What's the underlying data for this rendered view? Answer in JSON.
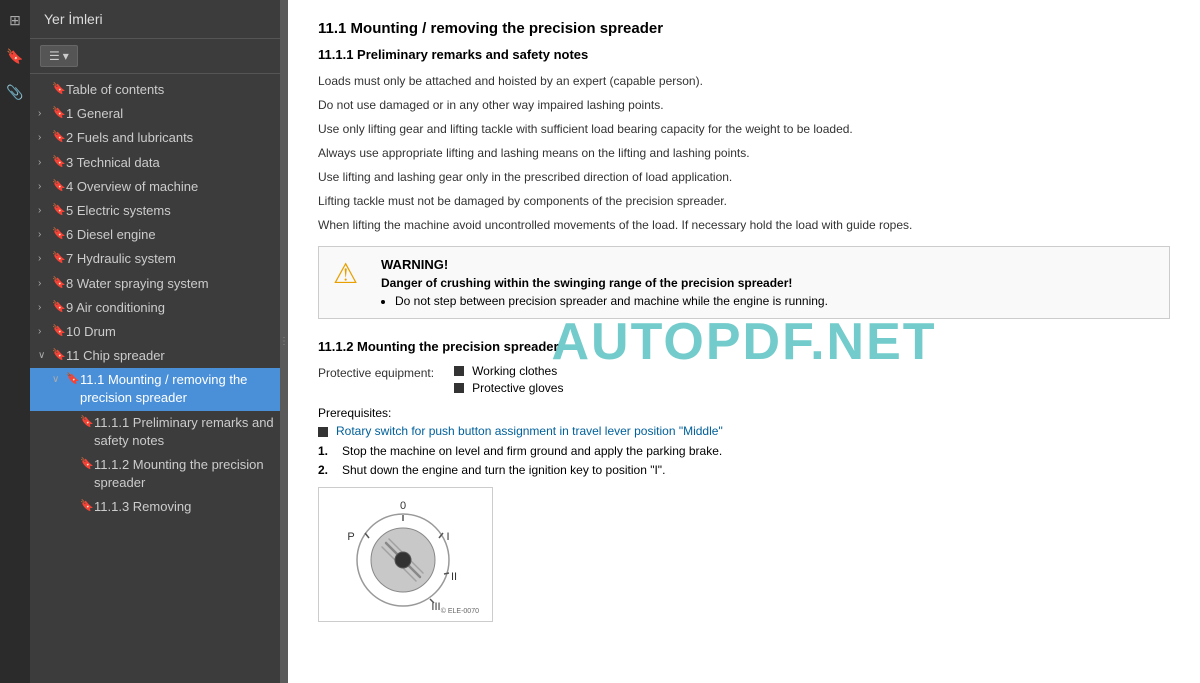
{
  "sidebar": {
    "title": "Yer İmleri",
    "close_label": "×",
    "toolbar": {
      "list_icon": "☰",
      "dropdown_icon": "▾"
    },
    "items": [
      {
        "id": "toc",
        "level": 0,
        "label": "Table of contents",
        "expanded": false,
        "has_expander": false
      },
      {
        "id": "1",
        "level": 0,
        "label": "1 General",
        "expanded": false,
        "has_expander": true
      },
      {
        "id": "2",
        "level": 0,
        "label": "2 Fuels and lubricants",
        "expanded": false,
        "has_expander": true
      },
      {
        "id": "3",
        "level": 0,
        "label": "3 Technical data",
        "expanded": false,
        "has_expander": true
      },
      {
        "id": "4",
        "level": 0,
        "label": "4 Overview of machine",
        "expanded": false,
        "has_expander": true
      },
      {
        "id": "5",
        "level": 0,
        "label": "5 Electric systems",
        "expanded": false,
        "has_expander": true
      },
      {
        "id": "6",
        "level": 0,
        "label": "6 Diesel engine",
        "expanded": false,
        "has_expander": true
      },
      {
        "id": "7",
        "level": 0,
        "label": "7 Hydraulic system",
        "expanded": false,
        "has_expander": true
      },
      {
        "id": "8",
        "level": 0,
        "label": "8 Water spraying system",
        "expanded": false,
        "has_expander": true
      },
      {
        "id": "9",
        "level": 0,
        "label": "9 Air conditioning",
        "expanded": false,
        "has_expander": true
      },
      {
        "id": "10",
        "level": 0,
        "label": "10 Drum",
        "expanded": false,
        "has_expander": true
      },
      {
        "id": "11",
        "level": 0,
        "label": "11 Chip spreader",
        "expanded": true,
        "has_expander": true
      },
      {
        "id": "11.1",
        "level": 1,
        "label": "11.1 Mounting / removing the precision spreader",
        "expanded": true,
        "has_expander": true,
        "active": true
      },
      {
        "id": "11.1.1",
        "level": 2,
        "label": "11.1.1 Preliminary remarks and safety notes",
        "expanded": false,
        "has_expander": false
      },
      {
        "id": "11.1.2",
        "level": 2,
        "label": "11.1.2 Mounting the precision spreader",
        "expanded": false,
        "has_expander": false
      },
      {
        "id": "11.1.3",
        "level": 2,
        "label": "11.1.3 Removing",
        "expanded": false,
        "has_expander": false
      }
    ]
  },
  "icons": [
    {
      "id": "pages-icon",
      "symbol": "⊞",
      "active": false
    },
    {
      "id": "bookmarks-icon",
      "symbol": "🔖",
      "active": true
    },
    {
      "id": "attach-icon",
      "symbol": "📎",
      "active": false
    }
  ],
  "main": {
    "watermark": "AUTOPDF.NET",
    "section_11_1": {
      "title": "11.1   Mounting / removing the precision spreader",
      "subsection_11_1_1": {
        "title": "11.1.1   Preliminary remarks and safety notes",
        "paragraphs": [
          "Loads must only be attached and hoisted by an expert (capable person).",
          "Do not use damaged or in any other way impaired lashing points.",
          "Use only lifting gear and lifting tackle with sufficient load bearing capacity for the weight to be loaded.",
          "Always use appropriate lifting and lashing means on the lifting and lashing points.",
          "Use lifting and lashing gear only in the prescribed direction of load application.",
          "Lifting tackle must not be damaged by components of the precision spreader.",
          "When lifting the machine avoid uncontrolled movements of the load. If necessary hold the load with guide ropes."
        ],
        "warning": {
          "title": "WARNING!",
          "bold_text": "Danger of crushing within the swinging range of the precision spreader!",
          "list_items": [
            "Do not step between precision spreader and machine while the engine is running."
          ]
        }
      },
      "subsection_11_1_2": {
        "title": "11.1.2   Mounting the precision spreader",
        "protective_equipment_label": "Protective equipment:",
        "equipment": [
          "Working clothes",
          "Protective gloves"
        ],
        "prerequisites_label": "Prerequisites:",
        "prerequisites": [
          "Rotary switch for push button assignment in travel lever position \"Middle\""
        ],
        "steps": [
          "Stop the machine on level and firm ground and apply the parking brake.",
          "Shut down the engine and turn the ignition key to position \"I\"."
        ]
      }
    }
  }
}
